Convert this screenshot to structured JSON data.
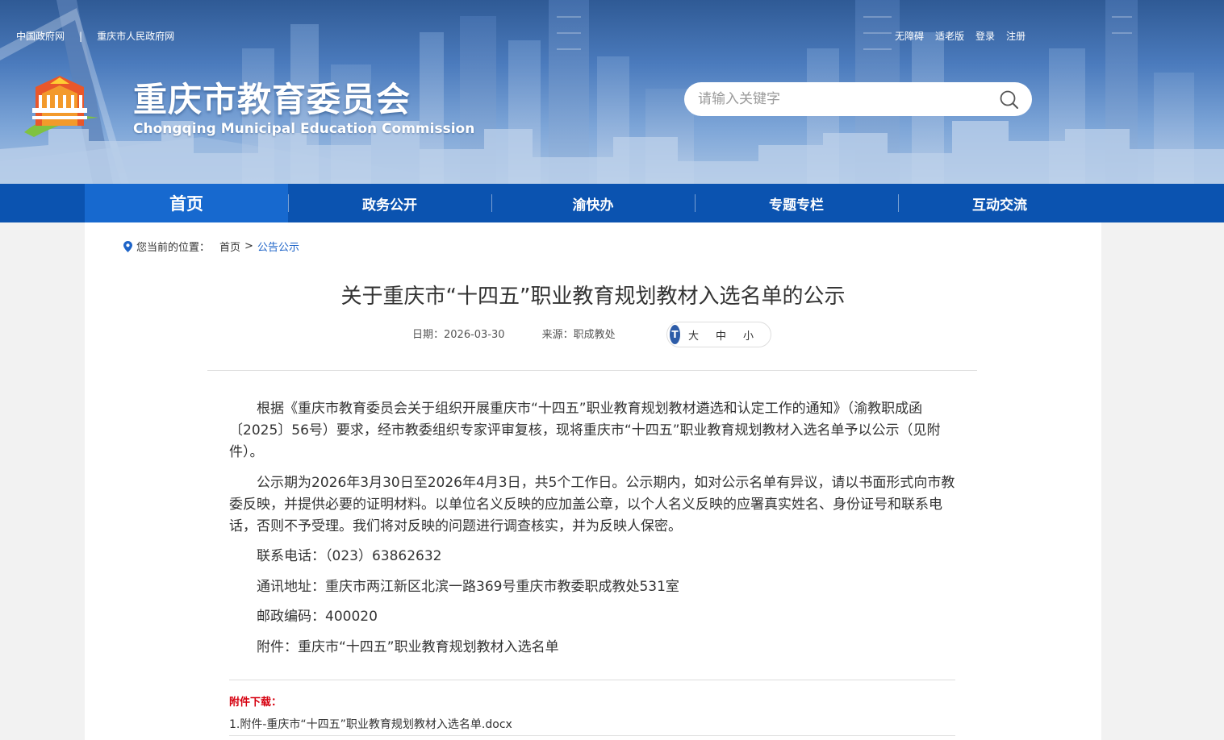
{
  "top_links": {
    "left": [
      "中国政府网",
      "重庆市人民政府网"
    ],
    "separator": "|",
    "right": [
      "无障碍",
      "适老版",
      "登录",
      "注册"
    ]
  },
  "logo": {
    "name_cn": "重庆市教育委员会",
    "name_en": "Chongqing Municipal Education Commission"
  },
  "search": {
    "placeholder": "请输入关键字"
  },
  "nav": {
    "items": [
      "首页",
      "政务公开",
      "渝快办",
      "专题专栏",
      "互动交流"
    ],
    "active": "首页"
  },
  "breadcrumb": {
    "prefix": "您当前的位置：",
    "home": "首页",
    "separator": ">",
    "current": "公告公示"
  },
  "article": {
    "title": "关于重庆市“十四五”职业教育规划教材入选名单的公示",
    "date": "日期：2026-03-30",
    "source": "来源：职成教处",
    "font_size": {
      "icon": "T",
      "options": [
        "大",
        "中",
        "小"
      ]
    },
    "paragraphs": [
      "根据《重庆市教育委员会关于组织开展重庆市“十四五”职业教育规划教材遴选和认定工作的通知》（渝教职成函〔2025〕56号）要求，经市教委组织专家评审复核，现将重庆市“十四五”职业教育规划教材入选名单予以公示（见附件）。",
      "公示期为2026年3月30日至2026年4月3日，共5个工作日。公示期内，如对公示名单有异议，请以书面形式向市教委反映，并提供必要的证明材料。以单位名义反映的应加盖公章，以个人名义反映的应署真实姓名、身份证号和联系电话，否则不予受理。我们将对反映的问题进行调查核实，并为反映人保密。",
      "联系电话：（023）63862632",
      "通讯地址：重庆市两江新区北滨一路369号重庆市教委职成教处531室",
      "邮政编码：400020",
      "附件：重庆市“十四五”职业教育规划教材入选名单"
    ],
    "attachments_title": "附件下载：",
    "attachments": [
      "1.附件-重庆市“十四五”职业教育规划教材入选名单.docx"
    ]
  },
  "colors": {
    "nav_bg": "#0b53b0",
    "nav_active": "#1769cf",
    "link": "#1e64c8",
    "attachment_title": "#d6000f"
  }
}
